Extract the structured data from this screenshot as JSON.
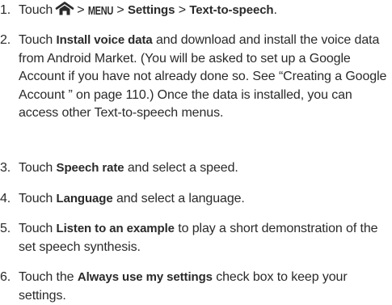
{
  "steps": [
    {
      "number": "1.",
      "parts": {
        "pre": "Touch",
        "sep1": ">",
        "menu_key": "MENU",
        "sep2": ">",
        "b1": "Settings",
        "sep3": ">",
        "b2": "Text-to-speech",
        "end": "."
      },
      "icon": "home-icon"
    },
    {
      "number": "2.",
      "parts": {
        "pre": "Touch ",
        "b1": "Install voice data",
        "post": " and download and install the voice data from Android Market. (You will be asked to set up a Google Account if you have not already done so. See “Creating a Google Account ” on page 110.) Once the data is installed, you can access other Text-to-speech menus."
      }
    },
    {
      "number": "3.",
      "parts": {
        "pre": "Touch ",
        "b1": "Speech rate",
        "post": " and select a speed."
      }
    },
    {
      "number": "4.",
      "parts": {
        "pre": "Touch ",
        "b1": "Language",
        "post": " and select a language."
      }
    },
    {
      "number": "5.",
      "parts": {
        "pre": "Touch ",
        "b1": "Listen to an example",
        "post": " to play a short demonstration of the set speech synthesis."
      }
    },
    {
      "number": "6.",
      "parts": {
        "pre": "Touch the ",
        "b1": "Always use my settings",
        "post": " check box to keep your settings."
      }
    }
  ]
}
